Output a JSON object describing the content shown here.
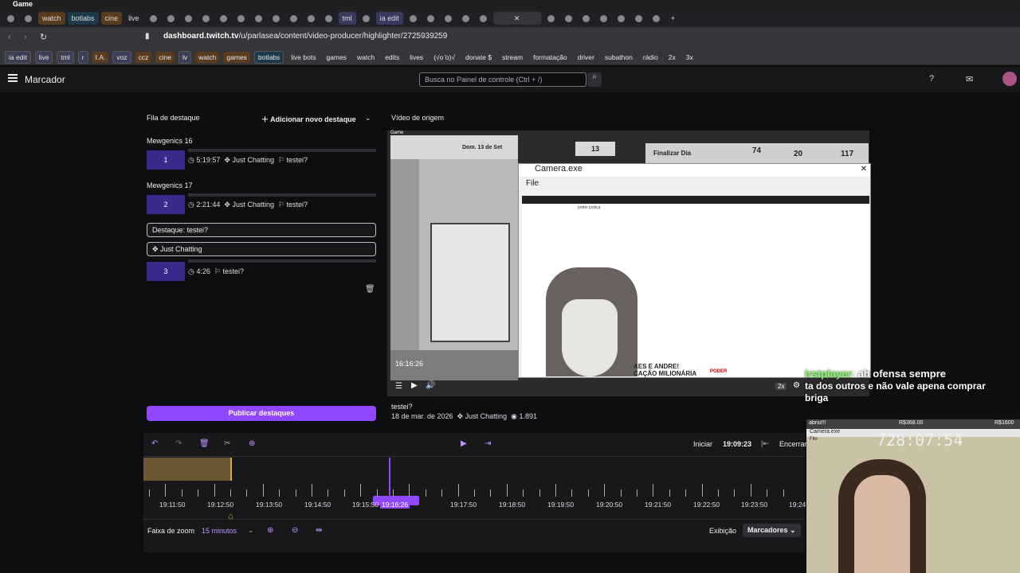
{
  "os": {
    "title": "Game"
  },
  "tabs": [
    "watch",
    "botlabs",
    "cine",
    "live",
    "tml",
    "ia edit"
  ],
  "browser": {
    "url_host": "dashboard.twitch.tv",
    "url_path": "/u/parlasea/content/video-producer/highlighter/2725939259"
  },
  "bookmarks": [
    "ia edit",
    "live",
    "tml",
    "r",
    "I.A.",
    "voz",
    "ccz",
    "cine",
    "lv",
    "watch",
    "games",
    "botlabs",
    "live bots",
    "games",
    "watch",
    "edits",
    "lives",
    "(√o ̄o)√",
    "donate $",
    "stream",
    "formatação",
    "driver",
    "subathon",
    "rádio",
    "2x",
    "3x"
  ],
  "header": {
    "title": "Marcador",
    "search_placeholder": "Busca no Painel de controle (Ctrl + /)"
  },
  "queue": {
    "title": "Fila de destaque",
    "add_label": "Adicionar novo destaque",
    "items": [
      {
        "name": "Mewgenics 16",
        "num": "1",
        "duration": "5:19:57",
        "category": "Just Chatting",
        "tag": "testei?"
      },
      {
        "name": "Mewgenics 17",
        "num": "2",
        "duration": "2:21:44",
        "category": "Just Chatting",
        "tag": "testei?"
      }
    ],
    "editing": {
      "title_value": "Destaque: testei?",
      "category_value": "Just Chatting",
      "num": "3",
      "duration": "4:26",
      "tag": "testei?"
    },
    "publish_label": "Publicar destaques"
  },
  "video": {
    "section_title": "Vídeo de origem",
    "current_time": "16:16:26",
    "clip_title": "testei?",
    "date": "18 de mar. de 2026",
    "category": "Just Chatting",
    "views": "1.891",
    "speed": "2x",
    "game_day": "Dom. 13 de Set",
    "game_counter": "13",
    "game_stats": [
      "74",
      "20",
      "117"
    ],
    "game_label": "Finalizar Dia",
    "game_title": "Game"
  },
  "camera_window": {
    "title": "Camera.exe",
    "menu_file": "File",
    "site": "poder justiça",
    "headline_lines": [
      "AES E ANDRE!",
      "CAÇÃO MILIONÁRIA"
    ],
    "brand": "PODER"
  },
  "timeline": {
    "start_label": "Iniciar",
    "start_time": "19:09:23",
    "end_label": "Encerrar",
    "ticks": [
      "19:11:50",
      "19:12:50",
      "19:13:50",
      "19:14:50",
      "19:15:50",
      "19:16:26",
      "19:17:50",
      "19:18:50",
      "19:19:50",
      "19:20:50",
      "19:21:50",
      "19:22:50",
      "19:23:50",
      "19:24"
    ],
    "zoom_label": "Faixa de zoom",
    "zoom_value": "15 minutos",
    "display_label": "Exibição",
    "markers_label": "Marcadores"
  },
  "stream": {
    "chat_user": "irstplayer",
    "chat_text": ": ah ofensa sempre",
    "chat_line2": "ta dos outros e não vale apena comprar",
    "chat_line3": "briga",
    "webcam_title": "abriu!!!",
    "donation_left": "R$368.00",
    "donation_right": "R$1600",
    "counter": "728:07:54",
    "webcam_window": "Camera.exe",
    "webcam_file": "File"
  },
  "colors": {
    "accent": "#9147ff",
    "timeline_gold": "#e8a33c"
  }
}
